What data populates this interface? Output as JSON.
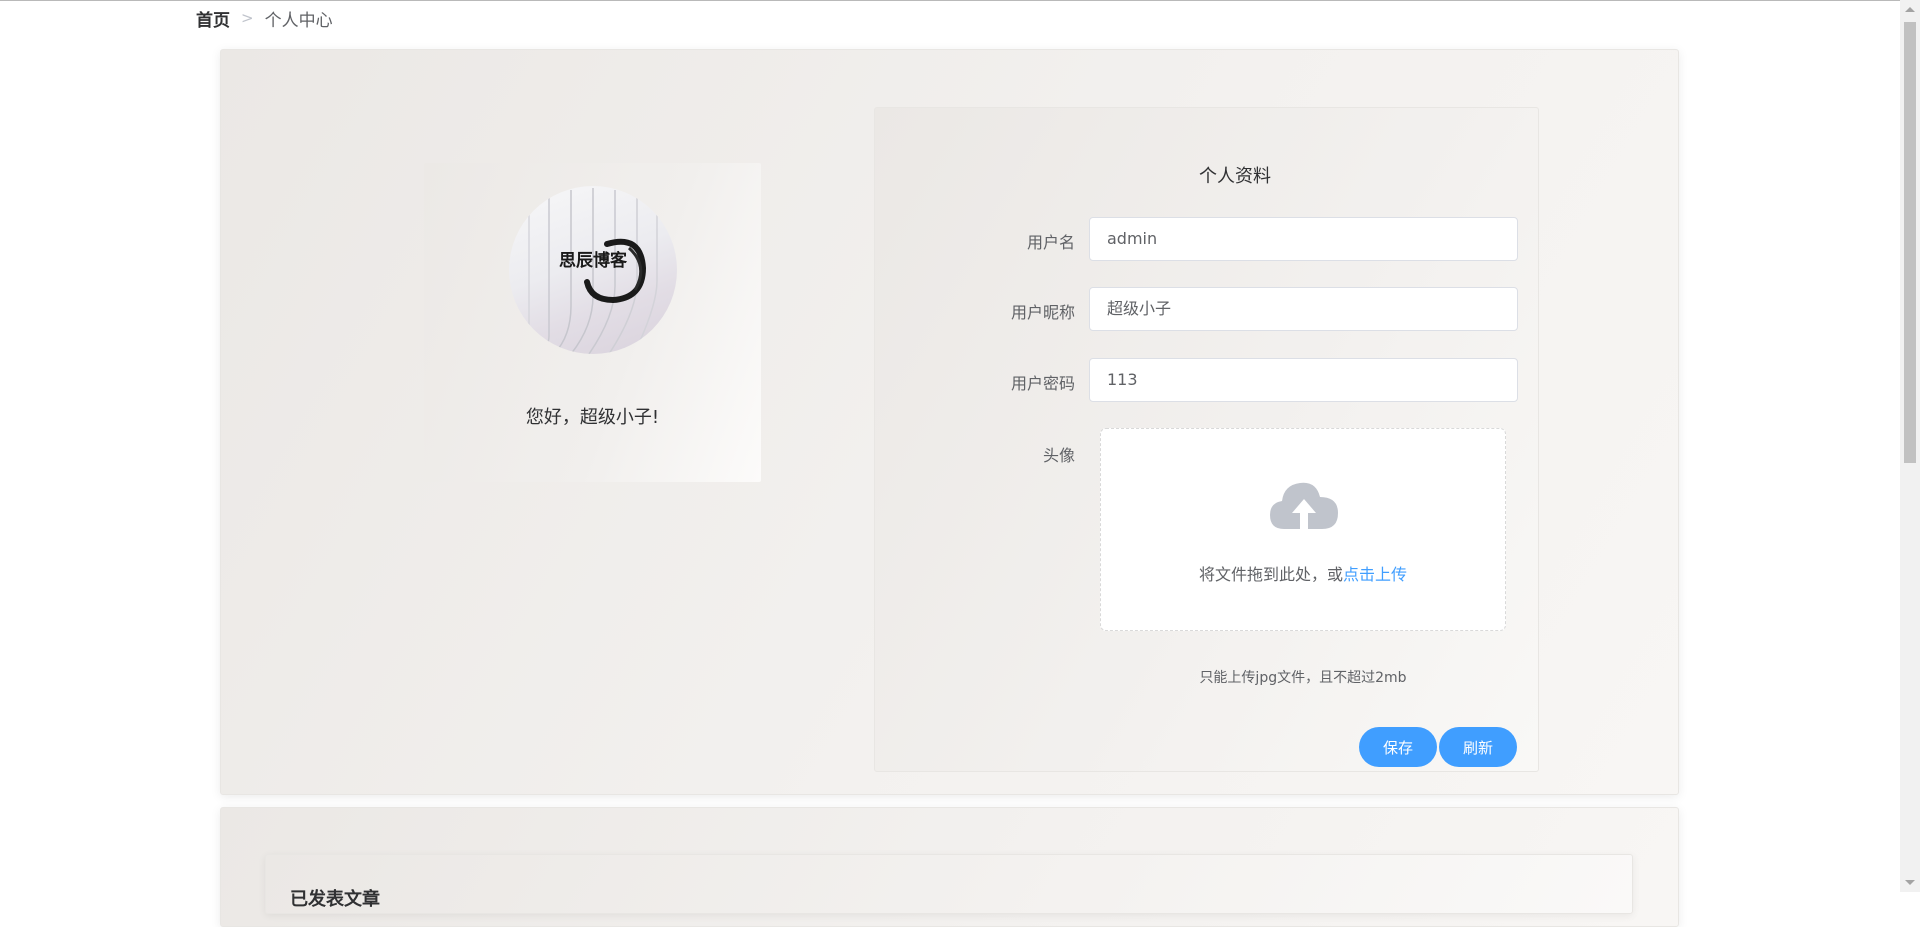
{
  "breadcrumb": {
    "home": "首页",
    "separator": ">",
    "current": "个人中心"
  },
  "profile": {
    "greeting": "您好，超级小子!",
    "avatar_logo_text": "思辰博客"
  },
  "form": {
    "title": "个人资料",
    "username_label": "用户名",
    "username_value": "admin",
    "nickname_label": "用户昵称",
    "nickname_value": "超级小子",
    "password_label": "用户密码",
    "password_value": "113",
    "avatar_label": "头像",
    "upload_text": "将文件拖到此处，或",
    "upload_link": "点击上传",
    "upload_tip": "只能上传jpg文件，且不超过2mb",
    "save_label": "保存",
    "refresh_label": "刷新"
  },
  "articles": {
    "title": "已发表文章"
  },
  "colors": {
    "primary": "#409eff",
    "text": "#303133",
    "label": "#606266"
  }
}
